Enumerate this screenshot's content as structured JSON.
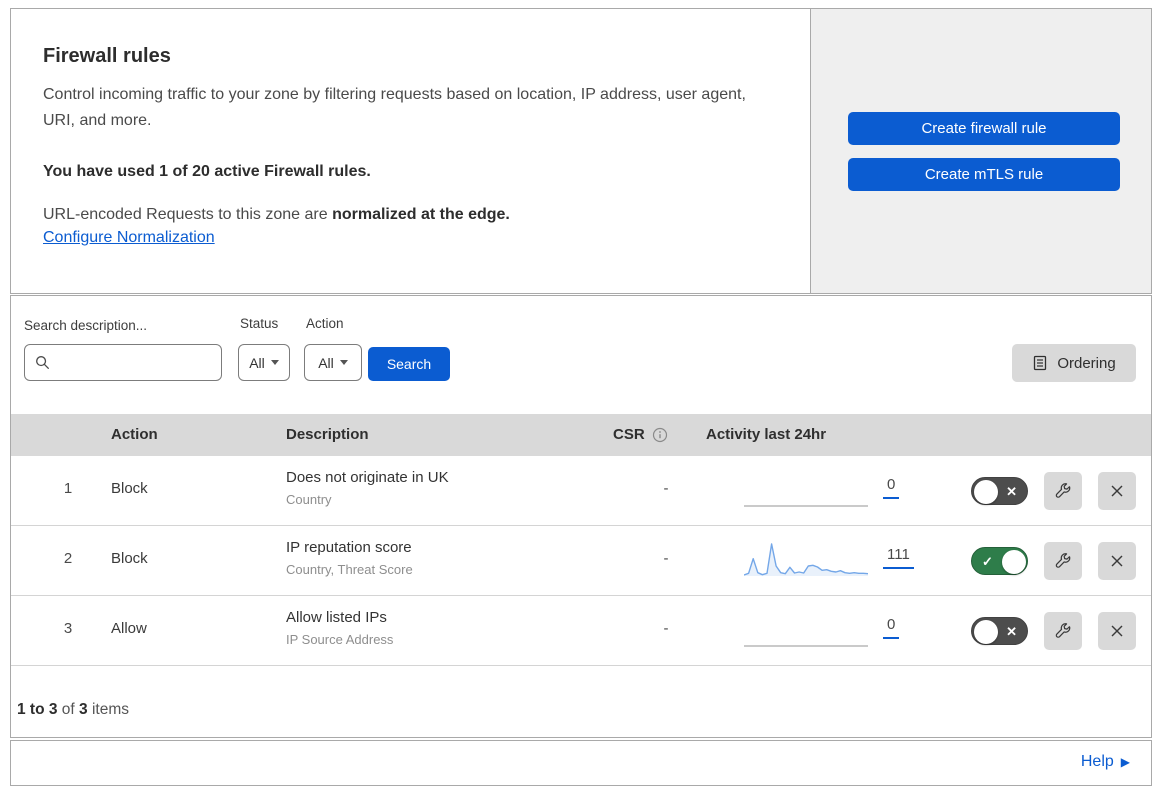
{
  "colors": {
    "accent_blue": "#0b5cd1",
    "toggle_on_green": "#2e7d4a",
    "toggle_off_gray": "#4d4d4d",
    "panel_gray": "#efefef",
    "table_header_gray": "#d9d9d9",
    "sparkline_blue": "#74a7e8"
  },
  "header": {
    "title": "Firewall rules",
    "description": "Control incoming traffic to your zone by filtering requests based on location, IP address, user agent, URI, and more.",
    "usage_bold": "You have used 1 of 20 active Firewall rules.",
    "normalization_text": "URL-encoded Requests to this zone are ",
    "normalization_bold": "normalized at the edge.",
    "config_link": "Configure Normalization",
    "buttons": [
      {
        "label": "Create firewall rule"
      },
      {
        "label": "Create mTLS rule"
      }
    ]
  },
  "filters": {
    "search_label": "Search description...",
    "status_label": "Status",
    "status_value": "All",
    "action_label": "Action",
    "action_value": "All",
    "search_button": "Search",
    "ordering_button": "Ordering"
  },
  "table": {
    "columns": {
      "action": "Action",
      "description": "Description",
      "csr": "CSR",
      "activity": "Activity last 24hr"
    },
    "rows": [
      {
        "num": "1",
        "action": "Block",
        "description": "Does not originate in UK",
        "fields": "Country",
        "csr": "-",
        "activity_count": "0",
        "enabled": false,
        "sparkline": null
      },
      {
        "num": "2",
        "action": "Block",
        "description": "IP reputation score",
        "fields": "Country, Threat Score",
        "csr": "-",
        "activity_count": "111",
        "enabled": true,
        "sparkline": [
          3,
          8,
          52,
          10,
          4,
          8,
          96,
          30,
          10,
          7,
          26,
          9,
          12,
          9,
          30,
          32,
          27,
          17,
          19,
          14,
          12,
          16,
          10,
          8,
          10,
          8,
          8,
          7
        ]
      },
      {
        "num": "3",
        "action": "Allow",
        "description": "Allow listed IPs",
        "fields": "IP Source Address",
        "csr": "-",
        "activity_count": "0",
        "enabled": false,
        "sparkline": null
      }
    ]
  },
  "footer": {
    "range_bold": "1 to 3",
    "of_text": " of ",
    "total_bold": "3",
    "items_text": " items"
  },
  "help": {
    "label": "Help"
  },
  "toggle_glyphs": {
    "check": "✓",
    "cross": "✕"
  }
}
